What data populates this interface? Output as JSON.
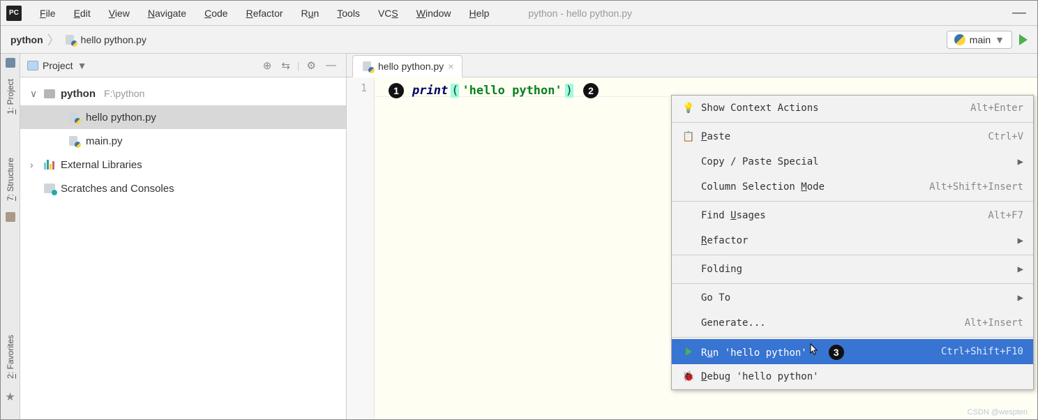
{
  "app": {
    "logo": "PC",
    "title_hint": "python - hello python.py"
  },
  "menubar": [
    {
      "label": "File",
      "accel": "F"
    },
    {
      "label": "Edit",
      "accel": "E"
    },
    {
      "label": "View",
      "accel": "V"
    },
    {
      "label": "Navigate",
      "accel": "N"
    },
    {
      "label": "Code",
      "accel": "C"
    },
    {
      "label": "Refactor",
      "accel": "R"
    },
    {
      "label": "Run",
      "accel": "u"
    },
    {
      "label": "Tools",
      "accel": "T"
    },
    {
      "label": "VCS",
      "accel": "S"
    },
    {
      "label": "Window",
      "accel": "W"
    },
    {
      "label": "Help",
      "accel": "H"
    }
  ],
  "breadcrumb": {
    "root": "python",
    "file": "hello python.py"
  },
  "run_config": {
    "name": "main"
  },
  "left_rail": {
    "project": "1: Project",
    "structure": "7: Structure",
    "favorites": "2: Favorites"
  },
  "project_panel": {
    "title": "Project",
    "root": {
      "name": "python",
      "path": "F:\\python"
    },
    "files": [
      "hello python.py",
      "main.py"
    ],
    "external": "External Libraries",
    "scratches": "Scratches and Consoles"
  },
  "editor": {
    "tab": "hello python.py",
    "line_no": "1",
    "code": {
      "fn": "print",
      "lpar": "(",
      "str": "'hello python'",
      "rpar": ")"
    },
    "callout1": "1",
    "callout2": "2"
  },
  "context_menu": {
    "items": [
      {
        "icon": "bulb",
        "label": "Show Context Actions",
        "sc": "Alt+Enter"
      },
      {
        "sep": true
      },
      {
        "icon": "paste",
        "label_u": "P",
        "label": "aste",
        "sc": "Ctrl+V"
      },
      {
        "label": "Copy / Paste Special",
        "sub": true
      },
      {
        "label_pre": "Column Selection ",
        "label_u": "M",
        "label": "ode",
        "sc": "Alt+Shift+Insert"
      },
      {
        "sep": true
      },
      {
        "label_pre": "Find ",
        "label_u": "U",
        "label": "sages",
        "sc": "Alt+F7"
      },
      {
        "label_u": "R",
        "label": "efactor",
        "sub": true
      },
      {
        "sep": true
      },
      {
        "label": "Folding",
        "sub": true
      },
      {
        "sep": true
      },
      {
        "label": "Go To",
        "sub": true
      },
      {
        "label": "Generate...",
        "sc": "Alt+Insert"
      },
      {
        "sep": true
      },
      {
        "highlight": true,
        "icon": "run",
        "label_pre": "R",
        "label_u": "u",
        "label": "n 'hello python'",
        "sc": "Ctrl+Shift+F10",
        "cursor": true,
        "callout": "3"
      },
      {
        "icon": "bug",
        "label_u": "D",
        "label": "ebug 'hello python'"
      }
    ]
  },
  "watermark": "CSDN @wespten"
}
